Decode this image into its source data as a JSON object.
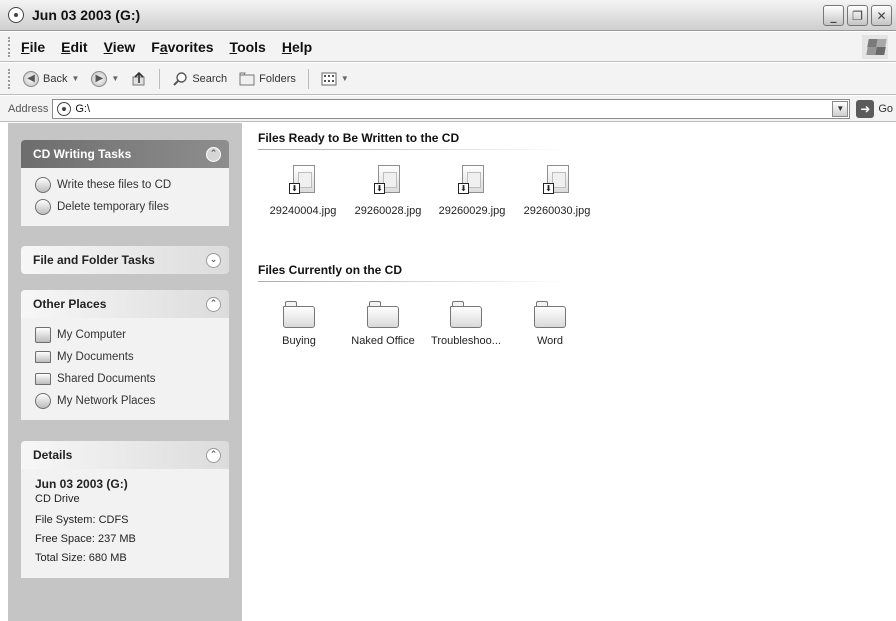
{
  "window": {
    "title": "Jun 03 2003 (G:)"
  },
  "menu": [
    {
      "label": "File",
      "key": "F",
      "rest": "ile"
    },
    {
      "label": "Edit",
      "key": "E",
      "rest": "dit"
    },
    {
      "label": "View",
      "key": "V",
      "rest": "iew"
    },
    {
      "label": "Favorites",
      "key_pre": "F",
      "key": "a",
      "rest": "vorites"
    },
    {
      "label": "Tools",
      "key": "T",
      "rest": "ools"
    },
    {
      "label": "Help",
      "key": "H",
      "rest": "elp"
    }
  ],
  "toolbar": {
    "back_label": "Back",
    "search_label": "Search",
    "folders_label": "Folders"
  },
  "address": {
    "label": "Address",
    "value": "G:\\",
    "go_label": "Go"
  },
  "sidebar": {
    "cd_tasks": {
      "title": "CD Writing Tasks",
      "items": [
        "Write these files to CD",
        "Delete temporary files"
      ]
    },
    "file_folder_tasks": {
      "title": "File and Folder Tasks"
    },
    "other_places": {
      "title": "Other Places",
      "items": [
        "My Computer",
        "My Documents",
        "Shared Documents",
        "My Network Places"
      ]
    },
    "details": {
      "title": "Details",
      "name": "Jun 03 2003 (G:)",
      "type": "CD Drive",
      "file_system": "File System: CDFS",
      "free_space": "Free Space: 237 MB",
      "total_size": "Total Size: 680 MB"
    }
  },
  "main": {
    "pending_title": "Files Ready to Be Written to the CD",
    "pending_files": [
      "29240004.jpg",
      "29260028.jpg",
      "29260029.jpg",
      "29260030.jpg"
    ],
    "current_title": "Files Currently on the CD",
    "current_folders": [
      "Buying",
      "Naked Office",
      "Troubleshoo...",
      "Word"
    ]
  },
  "icons": {
    "title": "cd-drive-icon",
    "back": "back-arrow-icon",
    "forward": "forward-arrow-icon",
    "up": "up-folder-icon",
    "search": "search-icon",
    "folders": "folders-icon",
    "views": "views-icon",
    "go": "go-arrow-icon"
  }
}
